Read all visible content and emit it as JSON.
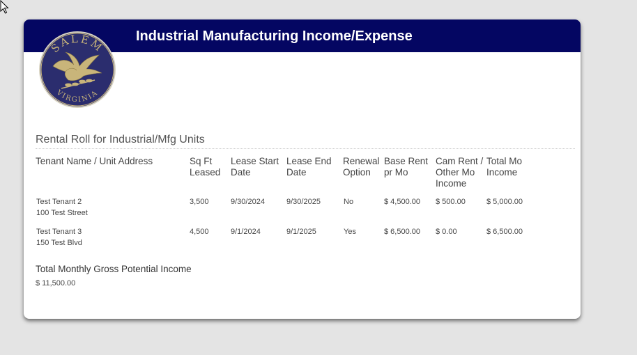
{
  "header": {
    "title": "Industrial Manufacturing Income/Expense"
  },
  "logo": {
    "icon": "salem-virginia-seal-icon",
    "top_text": "SALEM",
    "bottom_text": "VIRGINIA",
    "colors": {
      "background": "#2b2d6e",
      "gold": "#c9b57a"
    }
  },
  "colors": {
    "header_bg": "#040662",
    "page_bg": "#e4e4e4"
  },
  "section": {
    "title": "Rental Roll for Industrial/Mfg Units"
  },
  "table": {
    "headers": {
      "tenant": [
        "Tenant Name / Unit Address"
      ],
      "sqft": [
        "Sq Ft",
        "Leased"
      ],
      "lease_start": [
        "Lease Start",
        "Date"
      ],
      "lease_end": [
        "Lease End",
        "Date"
      ],
      "renewal": [
        "Renewal",
        "Option"
      ],
      "base_rent": [
        "Base Rent",
        "pr Mo"
      ],
      "cam_rent": [
        "Cam Rent /",
        "Other Mo",
        "Income"
      ],
      "total_mo": [
        "Total Mo",
        "Income"
      ]
    },
    "rows": [
      {
        "tenant_name": "Test Tenant 2",
        "address": "100 Test Street",
        "sqft": "3,500",
        "lease_start": "9/30/2024",
        "lease_end": "9/30/2025",
        "renewal": "No",
        "base_rent": "$ 4,500.00",
        "cam_rent": "$ 500.00",
        "total_mo": "$ 5,000.00"
      },
      {
        "tenant_name": "Test Tenant 3",
        "address": "150 Test Blvd",
        "sqft": "4,500",
        "lease_start": "9/1/2024",
        "lease_end": "9/1/2025",
        "renewal": "Yes",
        "base_rent": "$ 6,500.00",
        "cam_rent": "$ 0.00",
        "total_mo": "$ 6,500.00"
      }
    ]
  },
  "totals": {
    "label": "Total Monthly Gross Potential Income",
    "value": "$ 11,500.00"
  },
  "cursor": {
    "icon": "mouse-pointer-icon"
  }
}
